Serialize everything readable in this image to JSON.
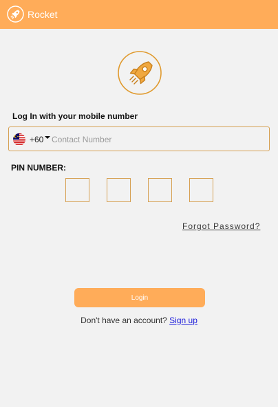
{
  "header": {
    "app_name": "Rocket",
    "logo_icon": "rocket-icon",
    "background_color": "#ffac59"
  },
  "hero": {
    "logo_icon": "rocket-icon",
    "accent_color": "#e09a2e"
  },
  "login": {
    "heading": "Log In with your mobile number",
    "country_flag": "malaysia-flag-icon",
    "country_code": "+60",
    "phone_value": "",
    "phone_placeholder": "Contact Number",
    "pin_label": "PIN NUMBER:",
    "pin_digits": [
      "",
      "",
      "",
      ""
    ],
    "forgot_password": "Forgot Password?",
    "login_button": "Login",
    "signup_prompt": "Don't have an account?",
    "signup_link": "Sign up"
  },
  "colors": {
    "accent": "#ffac59",
    "border": "#d6a052",
    "link": "#1a1adb",
    "background": "#f2f2f2"
  }
}
